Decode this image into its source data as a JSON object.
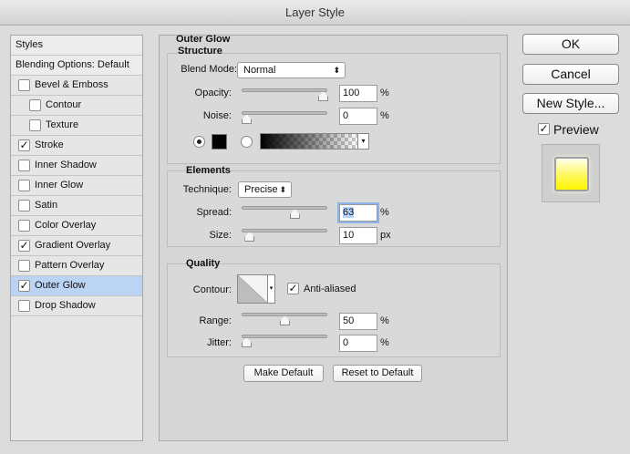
{
  "window": {
    "title": "Layer Style"
  },
  "sidebar": {
    "header": "Styles",
    "blending": "Blending Options: Default",
    "items": [
      {
        "label": "Bevel & Emboss",
        "checked": false
      },
      {
        "label": "Contour",
        "checked": false
      },
      {
        "label": "Texture",
        "checked": false
      },
      {
        "label": "Stroke",
        "checked": true
      },
      {
        "label": "Inner Shadow",
        "checked": false
      },
      {
        "label": "Inner Glow",
        "checked": false
      },
      {
        "label": "Satin",
        "checked": false
      },
      {
        "label": "Color Overlay",
        "checked": false
      },
      {
        "label": "Gradient Overlay",
        "checked": true
      },
      {
        "label": "Pattern Overlay",
        "checked": false
      },
      {
        "label": "Outer Glow",
        "checked": true
      },
      {
        "label": "Drop Shadow",
        "checked": false
      }
    ],
    "check_glyph": "✓"
  },
  "panel": {
    "title": "Outer Glow",
    "structure": {
      "title": "Structure",
      "blend_mode_label": "Blend Mode:",
      "blend_mode_value": "Normal",
      "opacity_label": "Opacity:",
      "opacity_value": "100",
      "opacity_unit": "%",
      "opacity_level": 100,
      "noise_label": "Noise:",
      "noise_value": "0",
      "noise_unit": "%",
      "noise_level": 0,
      "glow_color": "#000000"
    },
    "elements": {
      "title": "Elements",
      "technique_label": "Technique:",
      "technique_value": "Precise",
      "spread_label": "Spread:",
      "spread_value": "63",
      "spread_unit": "%",
      "spread_level": 63,
      "size_label": "Size:",
      "size_value": "10",
      "size_unit": "px",
      "size_level": 4
    },
    "quality": {
      "title": "Quality",
      "contour_label": "Contour:",
      "anti_aliased_label": "Anti-aliased",
      "anti_aliased": true,
      "range_label": "Range:",
      "range_value": "50",
      "range_unit": "%",
      "range_level": 50,
      "jitter_label": "Jitter:",
      "jitter_value": "0",
      "jitter_unit": "%",
      "jitter_level": 0
    },
    "make_default": "Make Default",
    "reset_default": "Reset to Default"
  },
  "actions": {
    "ok": "OK",
    "cancel": "Cancel",
    "new_style": "New Style...",
    "preview_label": "Preview",
    "preview_checked": true
  }
}
